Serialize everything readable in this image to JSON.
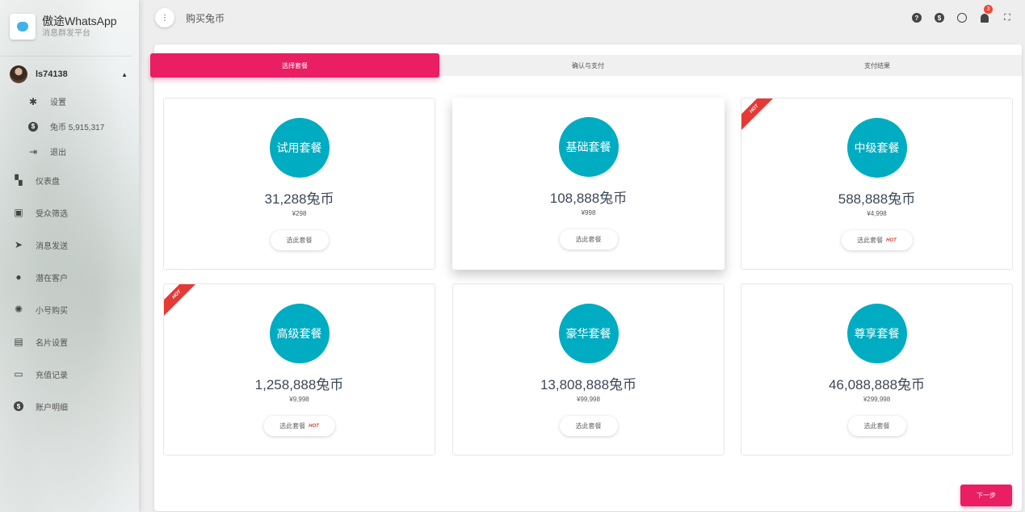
{
  "brand": {
    "name": "傲途WhatsApp",
    "subtitle": "消息群发平台"
  },
  "user": {
    "name": "ls74138"
  },
  "user_menu": [
    {
      "label": "设置",
      "icon": "gear-icon"
    },
    {
      "label": "兔币 5,915,317",
      "icon": "dollar-circle-icon"
    },
    {
      "label": "退出",
      "icon": "logout-icon"
    }
  ],
  "nav": [
    {
      "label": "仪表盘",
      "icon": "dashboard-icon"
    },
    {
      "label": "受众筛选",
      "icon": "contacts-icon"
    },
    {
      "label": "消息发送",
      "icon": "send-icon"
    },
    {
      "label": "潜在客户",
      "icon": "person-icon"
    },
    {
      "label": "小号购买",
      "icon": "aperture-icon"
    },
    {
      "label": "名片设置",
      "icon": "id-card-icon"
    },
    {
      "label": "充值记录",
      "icon": "recharge-icon"
    },
    {
      "label": "账户明细",
      "icon": "dollar-circle-icon"
    }
  ],
  "header": {
    "title": "购买兔币",
    "notification_count": "3"
  },
  "steps": [
    "选择套餐",
    "确认与支付",
    "支付结果"
  ],
  "packages": [
    {
      "name": "试用套餐",
      "amount": "31,288兔币",
      "price": "¥298",
      "button": "选此套餐",
      "hot": false
    },
    {
      "name": "基础套餐",
      "amount": "108,888兔币",
      "price": "¥998",
      "button": "选此套餐",
      "hot": false
    },
    {
      "name": "中级套餐",
      "amount": "588,888兔币",
      "price": "¥4,998",
      "button": "选此套餐",
      "hot": true
    },
    {
      "name": "高级套餐",
      "amount": "1,258,888兔币",
      "price": "¥9,998",
      "button": "选此套餐",
      "hot": true
    },
    {
      "name": "豪华套餐",
      "amount": "13,808,888兔币",
      "price": "¥99,998",
      "button": "选此套餐",
      "hot": false
    },
    {
      "name": "尊享套餐",
      "amount": "46,088,888兔币",
      "price": "¥299,998",
      "button": "选此套餐",
      "hot": false
    }
  ],
  "hot_label": "HOT",
  "next_button": "下一步",
  "colors": {
    "accent": "#e91e63",
    "package_circle": "#00acc1",
    "hot": "#e53935"
  }
}
